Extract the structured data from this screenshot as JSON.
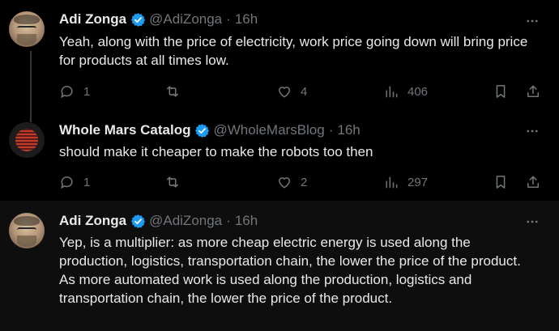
{
  "tweets": [
    {
      "name": "Adi Zonga",
      "handle": "@AdiZonga",
      "time": "16h",
      "text": "Yeah, along with the price of electricity, work price going down will bring price for products at all times low.",
      "replies": "1",
      "retweets": "",
      "likes": "4",
      "views": "406"
    },
    {
      "name": "Whole Mars Catalog",
      "handle": "@WholeMarsBlog",
      "time": "16h",
      "text": "should make it cheaper to make the robots too then",
      "replies": "1",
      "retweets": "",
      "likes": "2",
      "views": "297"
    },
    {
      "name": "Adi Zonga",
      "handle": "@AdiZonga",
      "time": "16h",
      "text": "Yep, is a multiplier: as more cheap electric energy is used along the production, logistics, transportation chain, the lower the price of the product.\nAs more automated work is used along the production, logistics and transportation chain, the lower the price of the product."
    }
  ],
  "colors": {
    "background": "#000000",
    "text": "#e7e9ea",
    "muted": "#71767b",
    "verified": "#1d9bf0"
  },
  "icons": [
    "verified-badge-icon",
    "more-icon",
    "reply-icon",
    "retweet-icon",
    "like-icon",
    "views-icon",
    "bookmark-icon",
    "share-icon"
  ]
}
